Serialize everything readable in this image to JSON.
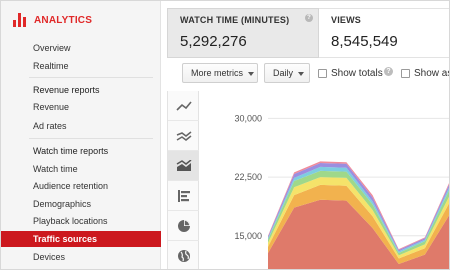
{
  "sidebar": {
    "brand_label": "ANALYTICS",
    "brand_color": "#e02828",
    "items": [
      {
        "label": "Overview"
      },
      {
        "label": "Realtime"
      },
      {
        "label": "Revenue reports"
      },
      {
        "label": "Revenue"
      },
      {
        "label": "Ad rates"
      },
      {
        "label": "Watch time reports"
      },
      {
        "label": "Watch time"
      },
      {
        "label": "Audience retention"
      },
      {
        "label": "Demographics"
      },
      {
        "label": "Playback locations"
      },
      {
        "label": "Traffic sources",
        "active": true
      },
      {
        "label": "Devices"
      }
    ]
  },
  "metrics": {
    "watch_time": {
      "title": "WATCH TIME (MINUTES)",
      "value": "5,292,276",
      "help": "?"
    },
    "views": {
      "title": "VIEWS",
      "value": "8,545,549"
    }
  },
  "toolbar": {
    "more_metrics": "More metrics",
    "period": "Daily",
    "show_totals": "Show totals",
    "show_as": "Show as",
    "help": "?"
  },
  "chart_icons": [
    "line-chart-icon",
    "multi-line-chart-icon",
    "stacked-area-chart-icon",
    "bar-chart-icon",
    "pie-chart-icon",
    "globe-icon"
  ],
  "chart_data": {
    "type": "area",
    "stacked": true,
    "y_ticks": [
      "30,000",
      "22,500",
      "15,000"
    ],
    "ylim": [
      10500,
      33500
    ],
    "x": [
      0,
      1,
      2,
      3,
      4,
      5,
      6,
      7
    ],
    "colors": [
      "#df7a6a",
      "#f2b24e",
      "#f5e36a",
      "#9fd88a",
      "#7ecde0",
      "#9b8ee0",
      "#f08a9a"
    ],
    "series": [
      {
        "values": [
          12800,
          18600,
          19600,
          19500,
          16000,
          11400,
          12600,
          18000
        ]
      },
      {
        "values": [
          800,
          1600,
          1900,
          1900,
          1500,
          700,
          800,
          1600
        ]
      },
      {
        "values": [
          500,
          1000,
          1000,
          1000,
          800,
          400,
          500,
          900
        ]
      },
      {
        "values": [
          400,
          800,
          800,
          800,
          700,
          300,
          400,
          800
        ]
      },
      {
        "values": [
          200,
          400,
          500,
          500,
          400,
          200,
          200,
          400
        ]
      },
      {
        "values": [
          200,
          500,
          500,
          500,
          500,
          200,
          200,
          400
        ]
      },
      {
        "values": [
          100,
          200,
          200,
          200,
          300,
          100,
          100,
          200
        ]
      }
    ]
  }
}
